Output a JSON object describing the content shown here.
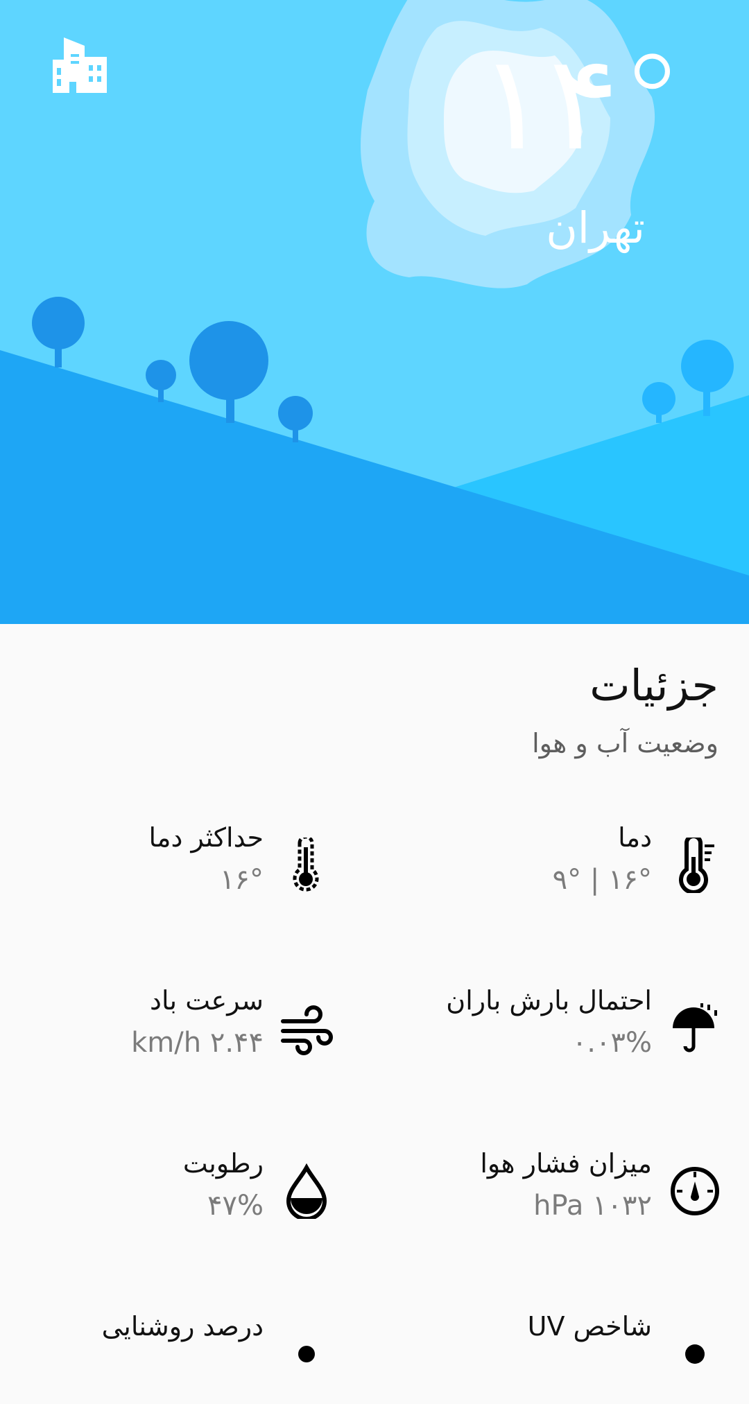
{
  "hero": {
    "temperature": "۱۴°",
    "city": "تهران",
    "city_button_icon": "city-buildings-icon",
    "colors": {
      "sky": "#5ed5ff",
      "hill_dark": "#1ea6f5",
      "hill_light": "#29c5ff",
      "tree": "#1e93e8"
    }
  },
  "details": {
    "title": "جزئیات",
    "subtitle": "وضعیت آب و هوا",
    "items": [
      {
        "label": "دما",
        "value": "۱۶° | ۹°",
        "icon": "thermometer-icon"
      },
      {
        "label": "حداکثر دما",
        "value": "۱۶°",
        "icon": "thermometer-max-icon"
      },
      {
        "label": "احتمال بارش باران",
        "value": "۰.۰۳%",
        "icon": "umbrella-rain-icon"
      },
      {
        "label": "سرعت  باد",
        "value": "۲.۴۴ km/h",
        "icon": "wind-icon"
      },
      {
        "label": "میزان فشار هوا",
        "value": "۱۰۳۲ hPa",
        "icon": "pressure-gauge-icon"
      },
      {
        "label": "رطوبت",
        "value": "۴۷%",
        "icon": "water-drop-icon"
      },
      {
        "label": "شاخص UV",
        "value": "",
        "icon": "uv-icon"
      },
      {
        "label": "درصد روشنایی",
        "value": "",
        "icon": "brightness-icon"
      }
    ]
  }
}
